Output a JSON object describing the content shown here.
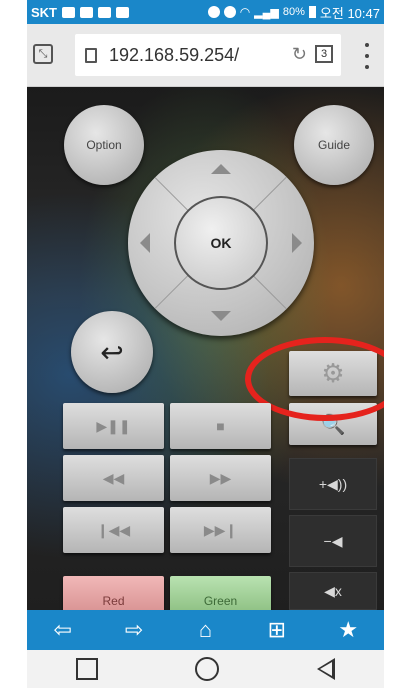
{
  "status_bar": {
    "carrier": "SKT",
    "battery": "80%",
    "time": "오전 10:47"
  },
  "url_bar": {
    "url": "192.168.59.254/",
    "tab_count": "3"
  },
  "remote": {
    "option_label": "Option",
    "guide_label": "Guide",
    "ok_label": "OK",
    "red_label": "Red",
    "green_label": "Green"
  },
  "icons": {
    "play_pause": "▶❚❚",
    "stop": "■",
    "rewind": "◀◀",
    "fast_forward": "▶▶",
    "prev": "❙◀◀",
    "next": "▶▶❙",
    "settings": "⚙",
    "vol_up": "+◀))",
    "vol_down": "−◀",
    "mute": "◀x",
    "back": "⇦",
    "forward": "⇨",
    "home": "⌂",
    "new_tab": "⊞",
    "bookmark": "★"
  },
  "colors": {
    "status_blue": "#1a87c9",
    "highlight_red": "#e5231d"
  }
}
